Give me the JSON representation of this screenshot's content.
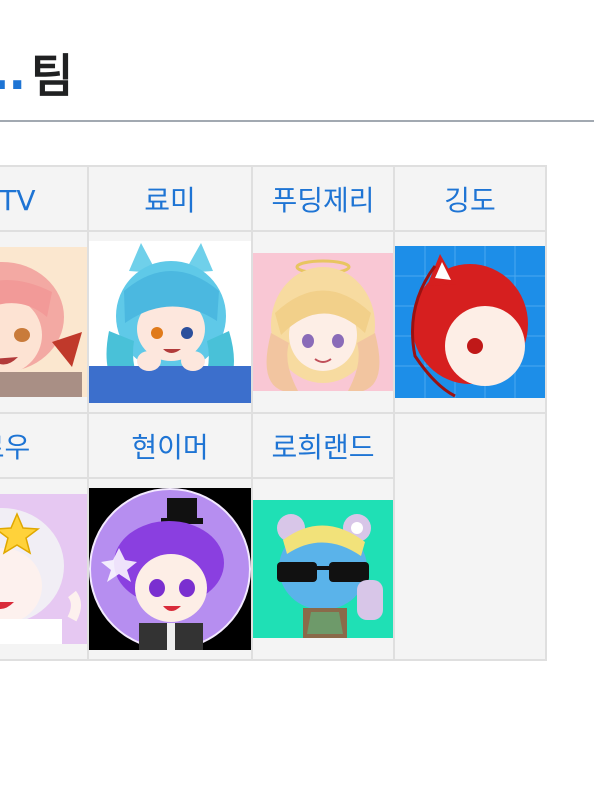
{
  "heading": {
    "prefix": "..",
    "title": "팀"
  },
  "members": [
    {
      "name": "사TV",
      "icon": "pink-haired-boy-avatar-icon"
    },
    {
      "name": "료미",
      "icon": "blue-haired-catgirl-avatar-icon"
    },
    {
      "name": "푸딩제리",
      "icon": "blonde-angel-girl-avatar-icon"
    },
    {
      "name": "깅도",
      "icon": "red-haired-foxgirl-avatar-icon"
    },
    {
      "name": "로우",
      "icon": "white-haired-star-girl-avatar-icon"
    },
    {
      "name": "현이머",
      "icon": "purple-haired-magician-avatar-icon"
    },
    {
      "name": "로희랜드",
      "icon": "blue-turtle-sunglasses-avatar-icon"
    }
  ],
  "colors": {
    "link": "#1e74d4",
    "cell_background": "#f4f4f4",
    "cell_border": "#dfdfdf",
    "rule": "#a2a9b1"
  }
}
